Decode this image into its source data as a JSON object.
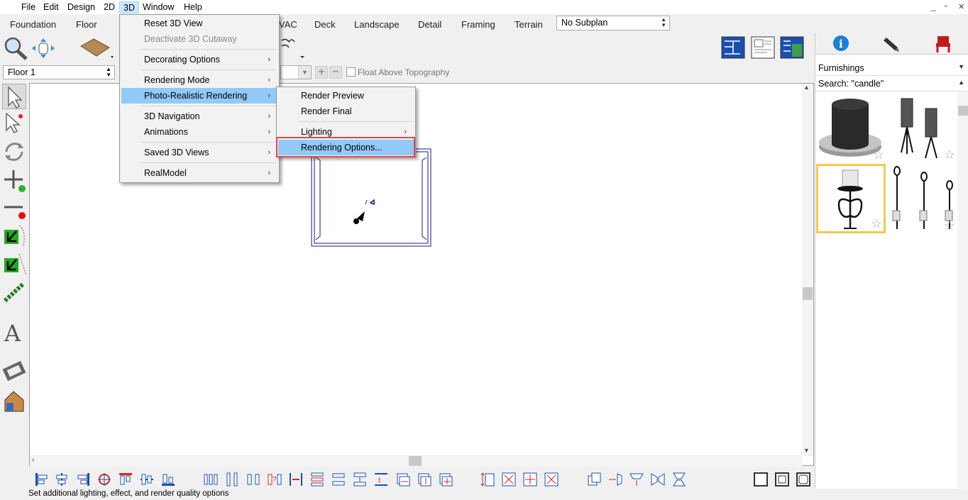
{
  "menubar": {
    "items": [
      "File",
      "Edit",
      "Design",
      "2D",
      "3D",
      "Window",
      "Help"
    ],
    "active": "3D",
    "window_controls": [
      "_",
      "▫",
      "✕"
    ]
  },
  "tabs": [
    "Foundation",
    "Floor",
    "VAC",
    "Deck",
    "Landscape",
    "Detail",
    "Framing",
    "Terrain"
  ],
  "subplan": {
    "value": "No Subplan"
  },
  "floor_selector": {
    "value": "Floor 1"
  },
  "float_option": {
    "label": "Float Above Topography",
    "checked": false
  },
  "menu_3d": {
    "items": [
      {
        "label": "Reset 3D View",
        "enabled": true,
        "submenu": false
      },
      {
        "label": "Deactivate 3D Cutaway",
        "enabled": false,
        "submenu": false
      },
      {
        "label": "Decorating Options",
        "enabled": true,
        "submenu": true
      },
      {
        "label": "Rendering Mode",
        "enabled": true,
        "submenu": true
      },
      {
        "label": "Photo-Realistic Rendering",
        "enabled": true,
        "submenu": true,
        "highlighted": true
      },
      {
        "label": "3D Navigation",
        "enabled": true,
        "submenu": true
      },
      {
        "label": "Animations",
        "enabled": true,
        "submenu": true
      },
      {
        "label": "Saved 3D Views",
        "enabled": true,
        "submenu": true
      },
      {
        "label": "RealModel",
        "enabled": true,
        "submenu": true
      }
    ]
  },
  "submenu_render": {
    "items": [
      {
        "label": "Render Preview",
        "submenu": false
      },
      {
        "label": "Render Final",
        "submenu": false
      },
      {
        "label": "Lighting",
        "submenu": true
      },
      {
        "label": "Rendering Options...",
        "submenu": false,
        "highlighted": true
      }
    ]
  },
  "right_panel": {
    "category": "Furnishings",
    "search": "Search: \"candle\"",
    "tab_icons": [
      "info-icon",
      "pen-icon",
      "chair-icon"
    ],
    "thumbnails": [
      {
        "name": "large-round-candle",
        "selected": false
      },
      {
        "name": "twin-candle-lanterns",
        "selected": false
      },
      {
        "name": "wrought-iron-candle-holder",
        "selected": true
      },
      {
        "name": "tall-candle-stakes",
        "selected": false
      }
    ]
  },
  "status": {
    "text": "Set additional lighting, effect, and render quality options"
  },
  "colors": {
    "menu_highlight": "#91c9f7",
    "callout_border": "#e0474c",
    "selected_thumb": "#f7c948",
    "plan_line": "#1a1a8c"
  }
}
